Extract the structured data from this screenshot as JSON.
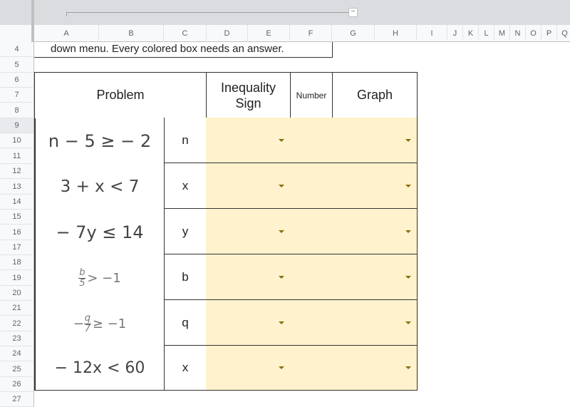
{
  "column_headers": [
    "A",
    "B",
    "C",
    "D",
    "E",
    "F",
    "G",
    "H",
    "I",
    "J",
    "K",
    "L",
    "M",
    "N",
    "O",
    "P",
    "Q"
  ],
  "row_headers": [
    "4",
    "5",
    "6",
    "7",
    "8",
    "9",
    "10",
    "11",
    "12",
    "13",
    "14",
    "15",
    "16",
    "17",
    "18",
    "19",
    "20",
    "21",
    "22",
    "23",
    "24",
    "25",
    "26",
    "27"
  ],
  "group_toggle": "−",
  "instruction_text": "down menu. Every colored box needs an answer.",
  "table": {
    "headers": {
      "problem": "Problem",
      "inequality_sign": "Inequality Sign",
      "number": "Number",
      "graph": "Graph"
    },
    "rows": [
      {
        "problem": "n − 5 ≥ − 2",
        "variable": "n",
        "inequality_sign": "",
        "graph": ""
      },
      {
        "problem": "3 + x < 7",
        "variable": "x",
        "inequality_sign": "",
        "graph": ""
      },
      {
        "problem": "− 7y ≤ 14",
        "variable": "y",
        "inequality_sign": "",
        "graph": ""
      },
      {
        "problem_num": "b",
        "problem_den": "5",
        "problem_rest": "> −1",
        "problem_prefix": "",
        "variable": "b",
        "inequality_sign": "",
        "graph": ""
      },
      {
        "problem_num": "q",
        "problem_den": "7",
        "problem_rest": "≥ −1",
        "problem_prefix": "−",
        "variable": "q",
        "inequality_sign": "",
        "graph": ""
      },
      {
        "problem": "− 12x <  60",
        "variable": "x",
        "inequality_sign": "",
        "graph": ""
      }
    ]
  },
  "colors": {
    "dropdown_fill": "#fff2cc",
    "dropdown_arrow": "#8a6d0b",
    "header_bg": "#f8f9fa",
    "grid_border": "#333333"
  }
}
